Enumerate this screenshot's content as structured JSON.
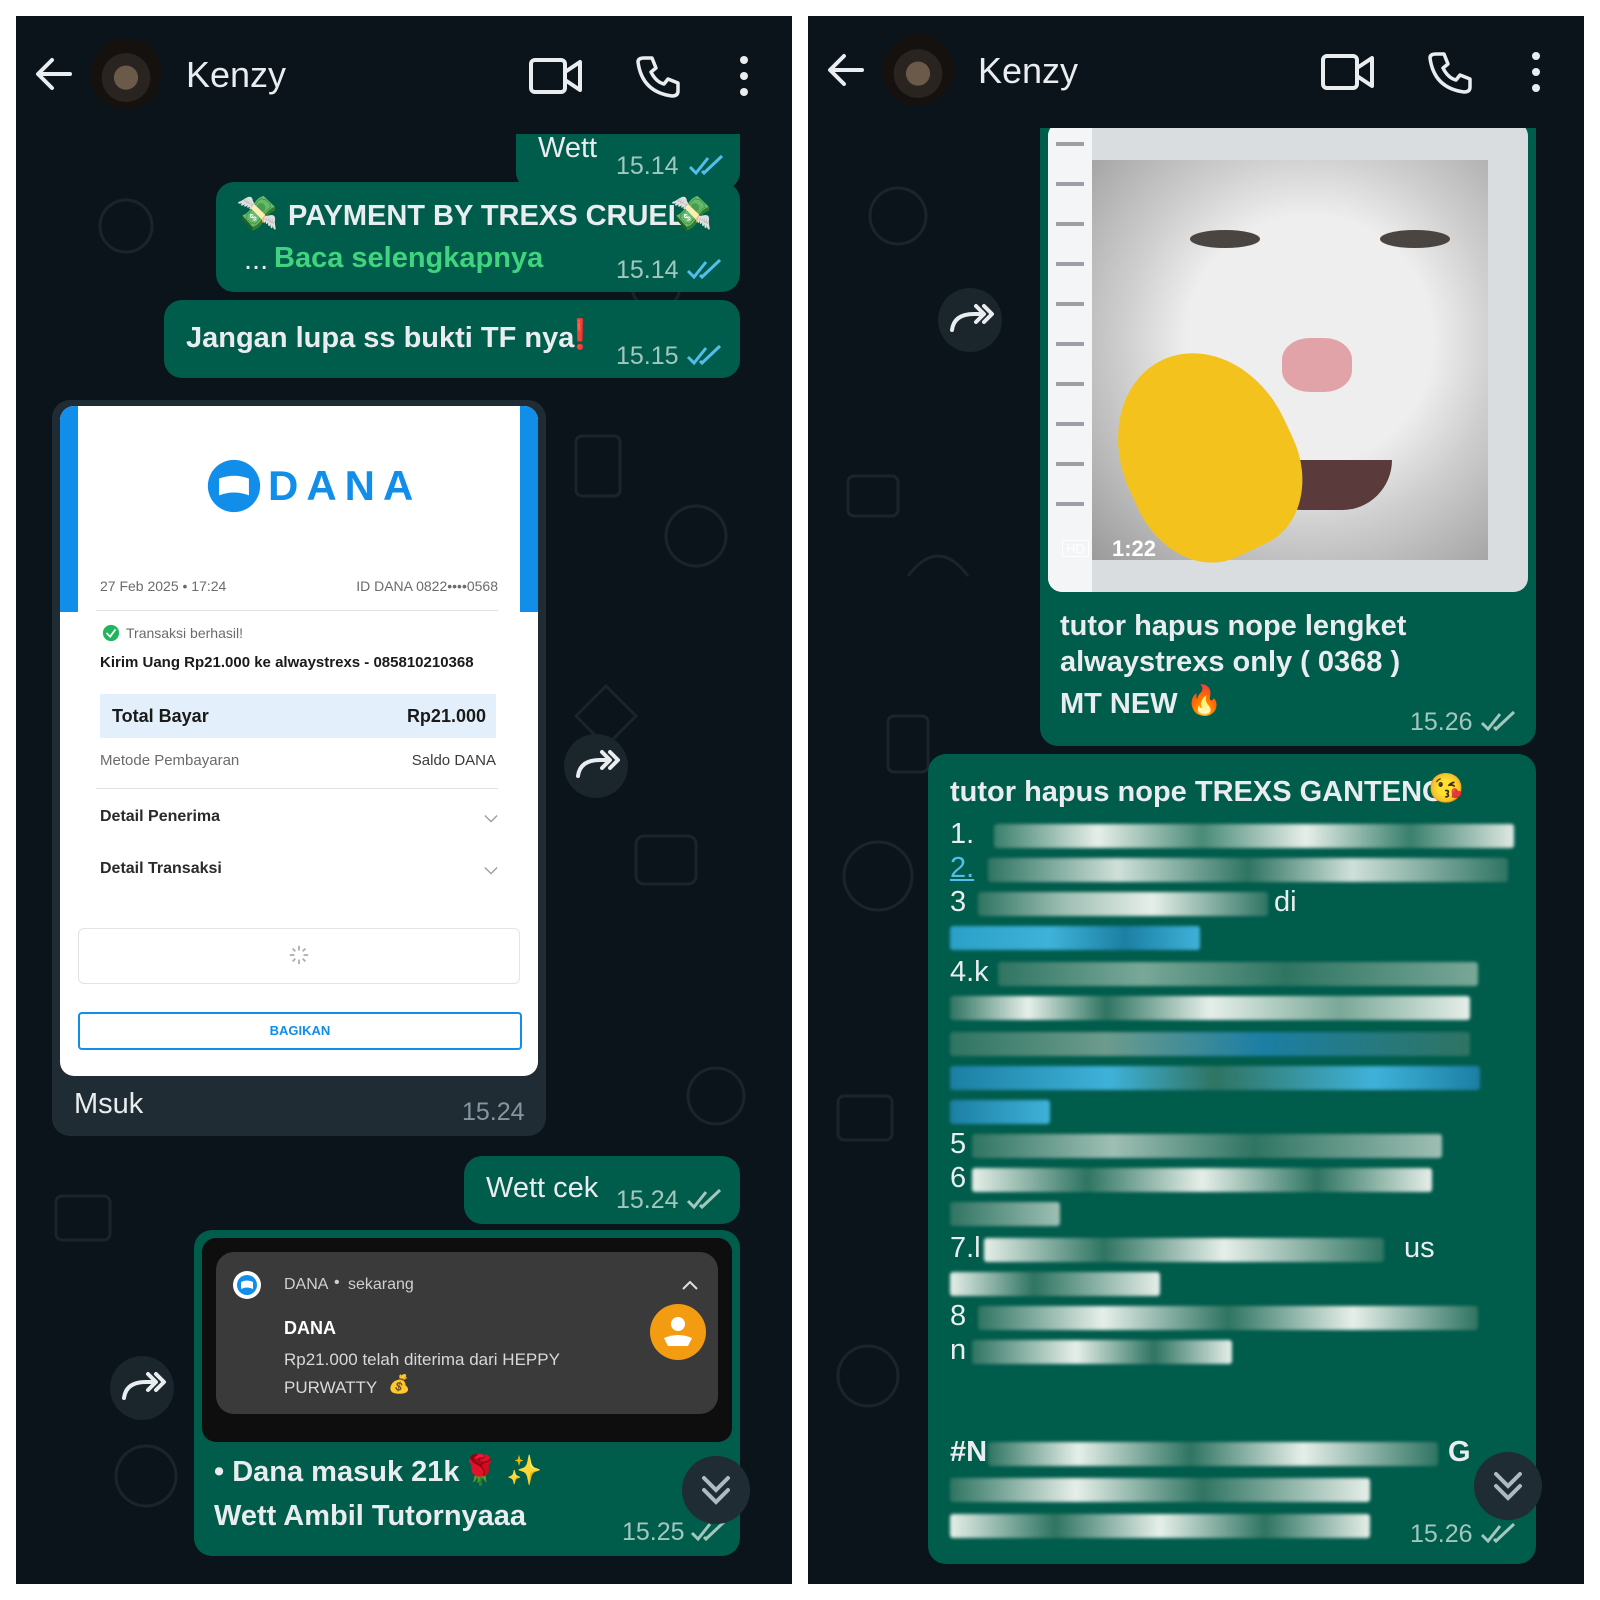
{
  "colors": {
    "chat_bg": "#0b141a",
    "bubble_out": "#005c4b",
    "bubble_in": "#202c33",
    "tick_blue": "#53bdeb",
    "tick_grey": "#a3c7bd",
    "link_green": "#3fd47d",
    "dana_blue": "#118eea",
    "dana_orange": "#f39c12"
  },
  "left": {
    "header": {
      "contact_name": "Kenzy"
    },
    "messages": {
      "m0": {
        "text": "Wett",
        "time": "15.14"
      },
      "m1": {
        "text": "PAYMENT BY TREXS CRUEL",
        "ellipsis": "...",
        "read_more": "Baca selengkapnya",
        "time": "15.14"
      },
      "m2": {
        "text": "Jangan lupa ss bukti TF nya",
        "mark": "❗",
        "time": "15.15"
      },
      "m3": {
        "caption": "Msuk",
        "time": "15.24",
        "receipt": {
          "brand": "DANA",
          "date": "27 Feb 2025 • 17:24",
          "id": "ID DANA 0822••••0568",
          "status": "Transaksi berhasil!",
          "description": "Kirim Uang Rp21.000 ke alwaystrexs - 085810210368",
          "total_label": "Total Bayar",
          "total_value": "Rp21.000",
          "method_label": "Metode Pembayaran",
          "method_value": "Saldo DANA",
          "detail_recipient": "Detail Penerima",
          "detail_transaction": "Detail Transaksi",
          "share_button": "BAGIKAN"
        }
      },
      "m4": {
        "text": "Wett cek",
        "time": "15.24"
      },
      "m5": {
        "notification": {
          "app": "DANA",
          "when": "sekarang",
          "title": "DANA",
          "body_line1": "Rp21.000 telah diterima dari HEPPY",
          "body_line2": "PURWATTY",
          "bag_emoji": "💰"
        },
        "line1": "• Dana masuk 21k",
        "line1_emoji": "🌹 ✨",
        "line2": "Wett Ambil Tutornyaaa",
        "time": "15.25"
      }
    }
  },
  "right": {
    "header": {
      "contact_name": "Kenzy"
    },
    "messages": {
      "r1": {
        "video_badge": "HD",
        "video_duration": "1:22",
        "line1": "tutor hapus nope lengket",
        "line2": "alwaystrexs only ( 0368 )",
        "line3": "MT NEW",
        "line3_emoji": "🔥",
        "time": "15.26"
      },
      "r2": {
        "title": "tutor hapus nope TREXS GANTENG",
        "title_emoji": "😘",
        "visible_fragments": {
          "l1": "1.",
          "l2": "2.",
          "l3": "3",
          "l3b": "di",
          "l5": "4.k",
          "l10": "5",
          "l11": "6",
          "l13": "7.l",
          "l13b": "us",
          "l15": "8",
          "l16": "n",
          "l18": "#N",
          "l18b": "G"
        },
        "time": "15.26"
      }
    }
  }
}
